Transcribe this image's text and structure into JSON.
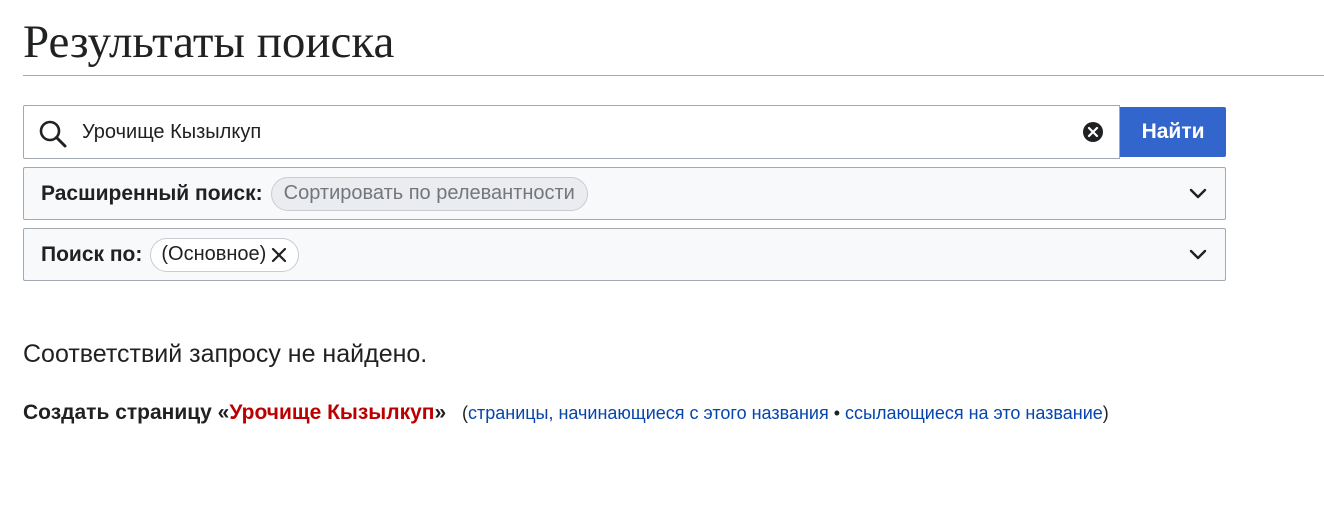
{
  "header": {
    "title": "Результаты поиска"
  },
  "search": {
    "value": "Урочище Кызылкуп",
    "button_label": "Найти"
  },
  "advanced": {
    "label": "Расширенный поиск:",
    "chip": "Сортировать по релевантности"
  },
  "namespace": {
    "label": "Поиск по:",
    "chip": "(Основное)"
  },
  "results": {
    "no_results": "Соответствий запросу не найдено.",
    "create_prefix": "Создать страницу «",
    "create_link": "Урочище Кызылкуп",
    "create_suffix": "»",
    "paren_open": "(",
    "link_prefix": "страницы, начинающиеся с этого названия",
    "separator": " • ",
    "link_backlinks": "ссылающиеся на это название",
    "paren_close": ")"
  },
  "icons": {
    "search": "search-icon",
    "clear": "clear-icon",
    "chip_close": "close-icon",
    "expand": "chevron-down-icon"
  },
  "colors": {
    "accent": "#3366cc",
    "redlink": "#ba0000",
    "link": "#0645ad",
    "border": "#a2a9b1",
    "panel_bg": "#f8f9fa"
  }
}
